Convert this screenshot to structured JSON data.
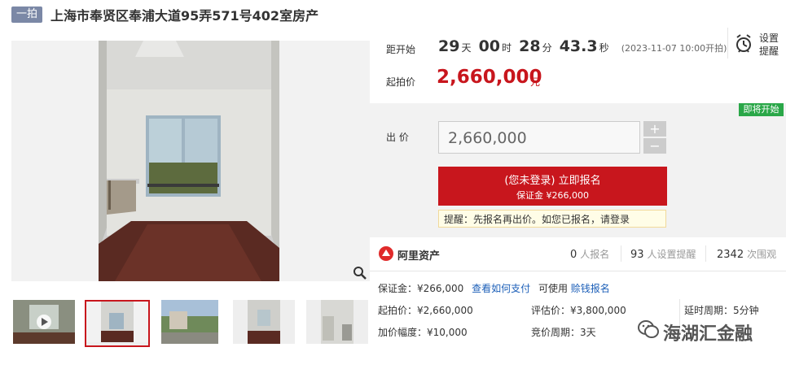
{
  "header": {
    "tag": "一拍",
    "title": "上海市奉贤区奉浦大道95弄571号402室房产"
  },
  "countdown": {
    "label": "距开始",
    "days": "29",
    "days_unit": "天",
    "hours": "00",
    "hours_unit": "时",
    "minutes": "28",
    "minutes_unit": "分",
    "seconds": "43.3",
    "seconds_unit": "秒",
    "start_note": "(2023-11-07 10:00开拍)"
  },
  "reminder": {
    "label_line1": "设置",
    "label_line2": "提醒",
    "icon": "alarm-clock-icon"
  },
  "starting_price": {
    "label": "起拍价",
    "value": "2,660,000",
    "unit": "元"
  },
  "status_tag": "即将开始",
  "bid": {
    "label": "出 价",
    "value": "2,660,000",
    "plus": "+",
    "minus": "−"
  },
  "signup": {
    "line1": "(您未登录) 立即报名",
    "line2": "保证金 ¥266,000"
  },
  "hint": "提醒：先报名再出价。如您已报名，请登录",
  "stats": {
    "brand": "阿里资产",
    "signups": "0",
    "signups_label": "人报名",
    "reminders": "93",
    "reminders_label": "人设置提醒",
    "views": "2342",
    "views_label": "次围观"
  },
  "details": {
    "deposit": "保证金：¥266,000",
    "how_to_pay": "查看如何支付",
    "can_use": "可使用",
    "loan_signup": "赊钱报名",
    "start_price": "起拍价：¥2,660,000",
    "assessed_price": "评估价：¥3,800,000",
    "delay_period": "延时周期：5分钟",
    "increment": "加价幅度：¥10,000",
    "bid_period": "竞价周期：3天"
  },
  "watermark": "海湖汇金融",
  "colors": {
    "accent": "#c8161d",
    "tag_bg": "#7b88a6",
    "status_green": "#2aa748",
    "link": "#1c5fb8"
  }
}
